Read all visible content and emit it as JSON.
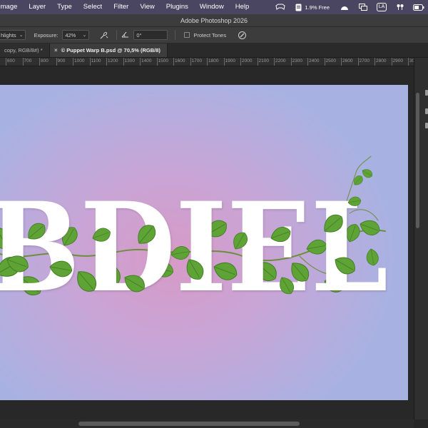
{
  "menubar": {
    "items": [
      "Image",
      "Layer",
      "Type",
      "Select",
      "Filter",
      "View",
      "Plugins",
      "Window",
      "Help"
    ],
    "free_memory": "1.9% Free",
    "input_source": "LA"
  },
  "window": {
    "title": "Adobe Photoshop 2026"
  },
  "options": {
    "range_value": "hlights",
    "exposure_label": "Exposure:",
    "exposure_value": "42%",
    "angle_value": "0°",
    "protect_tones_label": "Protect Tones",
    "protect_tones_checked": false
  },
  "tabs": [
    {
      "label": "copy, RGB/8#) *",
      "active": false
    },
    {
      "label": "© Puppet Warp B.psd @ 70,5% (RGB/8)",
      "active": true
    }
  ],
  "ruler": {
    "labels": [
      "600",
      "700",
      "800",
      "900",
      "1000",
      "1100",
      "1200",
      "1300",
      "1400",
      "1500",
      "1600",
      "1700",
      "1800",
      "1900",
      "2000",
      "2100",
      "2200",
      "2300",
      "2400",
      "2500",
      "2600",
      "2700",
      "2800",
      "2900",
      "3000"
    ]
  },
  "artwork": {
    "text": "BDIEL",
    "text_color": "#ffffff",
    "leaf_color": "#5fa336",
    "leaf_dark": "#3f7d22",
    "vine_color": "#6b8f3a"
  },
  "colors": {
    "menubar_bg": "#4a4560",
    "panel_bg": "#3c3c3c",
    "workspace_bg": "#282828",
    "canvas_center": "#d79ac6",
    "canvas_edge": "#a8b2e2"
  },
  "icons": {
    "airbrush": "airbrush-icon",
    "angle": "angle-icon",
    "pressure": "pressure-icon",
    "cast": "screen-mirror-icon",
    "battery": "battery-icon"
  }
}
